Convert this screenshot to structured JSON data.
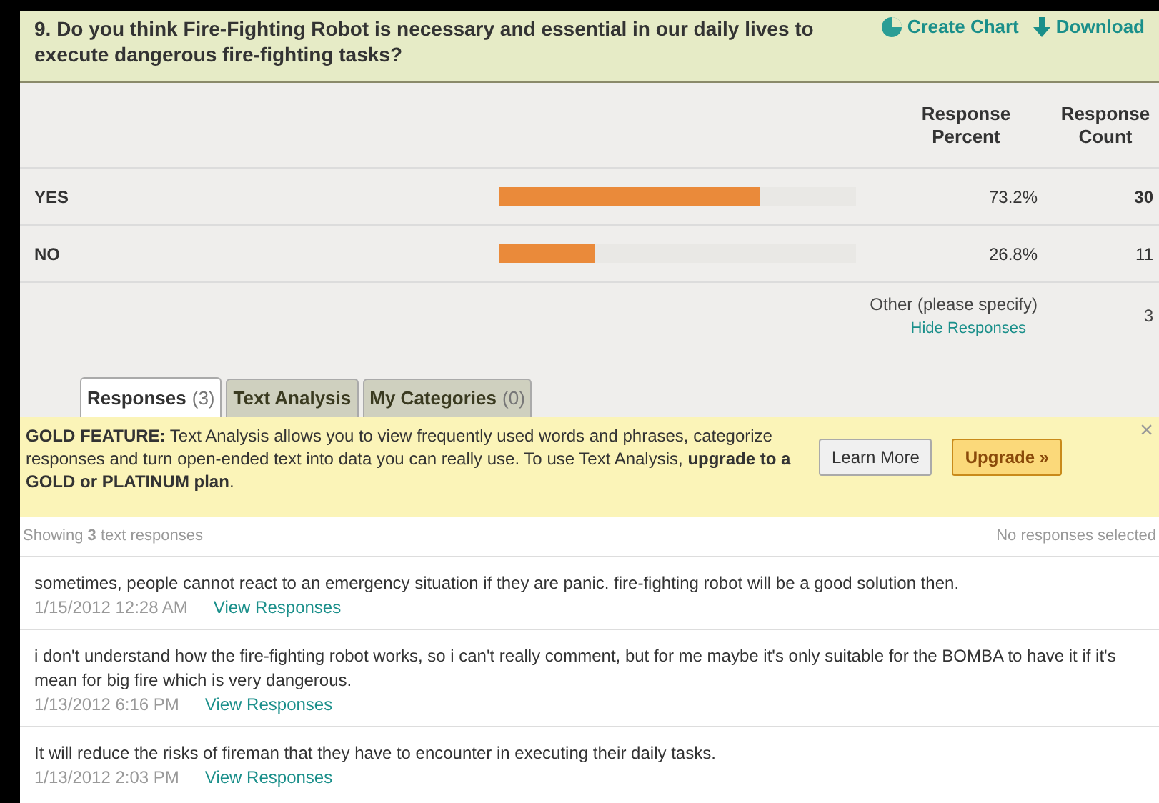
{
  "question": {
    "title": "9. Do you think Fire-Fighting Robot is necessary and essential in our daily lives to execute dangerous fire-fighting tasks?",
    "actions": [
      {
        "kind": "chart",
        "label": "Create Chart"
      },
      {
        "kind": "download",
        "label": "Download"
      }
    ]
  },
  "table": {
    "columns": [
      "Response Percent",
      "Response Count"
    ],
    "rows": [
      {
        "label": "YES",
        "level": 0.732,
        "percent": "73.2%",
        "count": "30"
      },
      {
        "label": "NO",
        "level": 0.268,
        "percent": "26.8%",
        "count": "11"
      }
    ],
    "other": {
      "label": "Other (please specify)",
      "link": "Hide Responses",
      "count": "3"
    }
  },
  "tabs": [
    {
      "label": "Responses",
      "count": "(3)",
      "selected": true
    },
    {
      "label": "Text Analysis",
      "selected": false
    },
    {
      "label": "My Categories",
      "count": "(0)",
      "selected": false
    }
  ],
  "banner": {
    "text": "**GOLD FEATURE:** Text Analysis allows you to view frequently used words and phrases, categorize responses and turn open-ended text into data you can really use. To use Text Analysis, **upgrade to a GOLD or PLATINUM plan**.",
    "buttons": [
      {
        "kind": "plain",
        "label": "Learn More"
      },
      {
        "kind": "primary",
        "label": "Upgrade »"
      }
    ],
    "close": "×"
  },
  "summary": {
    "showing": "Showing **3** text responses",
    "selected": "No responses selected"
  },
  "responses": [
    {
      "text": "sometimes, people cannot react to an emergency situation if they are panic. fire-fighting robot will be a good solution then.",
      "date": "1/15/2012 12:28 AM",
      "link": "View Responses"
    },
    {
      "text": "i don't understand how the fire-fighting robot works, so i can't really comment, but for me maybe it's only suitable for the BOMBA to have it if it's mean for big fire which is very dangerous.",
      "date": "1/13/2012 6:16 PM",
      "link": "View Responses"
    },
    {
      "text": "It will reduce the risks of fireman that they have to encounter in executing their daily tasks.",
      "date": "1/13/2012 2:03 PM",
      "link": "View Responses"
    }
  ]
}
